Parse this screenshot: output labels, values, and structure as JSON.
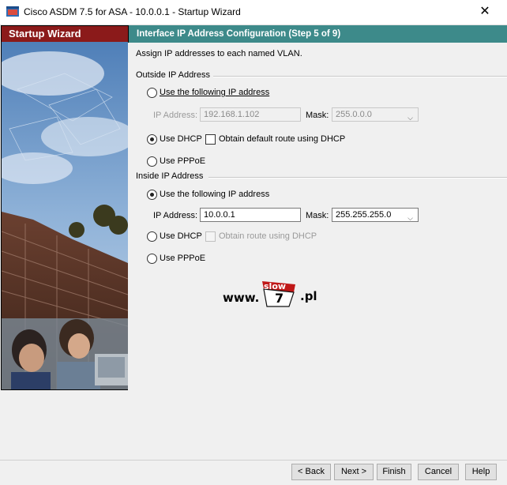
{
  "window": {
    "title": "Cisco ASDM 7.5 for ASA - 10.0.0.1 - Startup Wizard",
    "close_glyph": "✕"
  },
  "sidebar": {
    "heading": "Startup Wizard"
  },
  "step": {
    "header": "Interface IP Address Configuration  (Step 5 of 9)",
    "description": "Assign IP addresses to each named VLAN."
  },
  "outside": {
    "group_label": "Outside IP Address",
    "use_following_label": "Use the following IP address",
    "use_following_checked": false,
    "ip_label": "IP Address:",
    "ip_value": "192.168.1.102",
    "mask_label": "Mask:",
    "mask_value": "255.0.0.0",
    "dhcp_label": "Use DHCP",
    "dhcp_checked": true,
    "dhcp_route_label": "Obtain default route using DHCP",
    "pppoe_label": "Use PPPoE"
  },
  "inside": {
    "group_label": "Inside IP Address",
    "use_following_label": "Use the following IP address",
    "use_following_checked": true,
    "ip_label": "IP Address:",
    "ip_value": "10.0.0.1",
    "mask_label": "Mask:",
    "mask_value": "255.255.255.0",
    "dhcp_label": "Use DHCP",
    "dhcp_route_label": "Obtain route using DHCP",
    "pppoe_label": "Use PPPoE"
  },
  "watermark": {
    "prefix": "www.",
    "badge_top": "slow",
    "badge_number": "7",
    "suffix": ".pl"
  },
  "buttons": {
    "back": "< Back",
    "next": "Next >",
    "finish": "Finish",
    "cancel": "Cancel",
    "help": "Help"
  }
}
